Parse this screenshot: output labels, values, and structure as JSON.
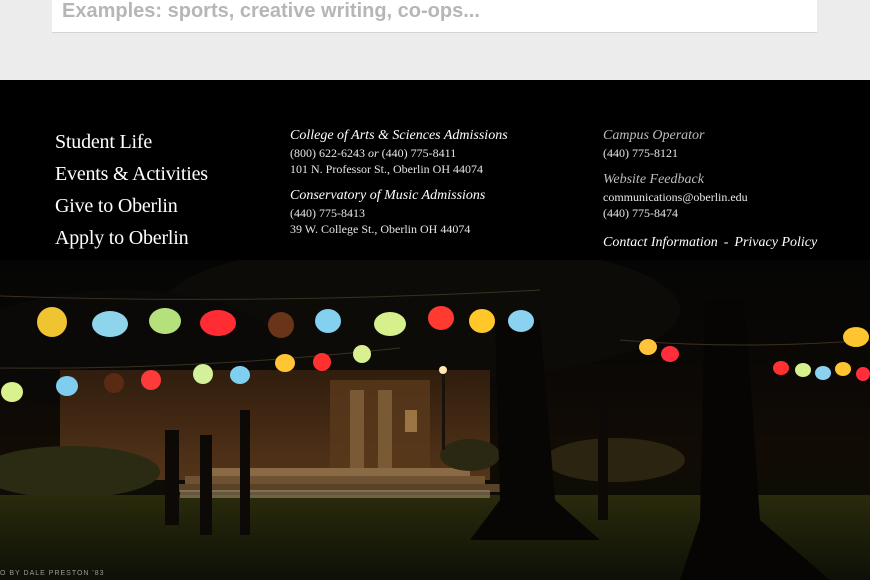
{
  "search": {
    "placeholder": "Examples: sports, creative writing, co-ops..."
  },
  "footer": {
    "nav": [
      "Student Life",
      "Events & Activities",
      "Give to Oberlin",
      "Apply to Oberlin"
    ],
    "arts_sciences": {
      "heading": "College of Arts & Sciences Admissions",
      "phone1": "(800) 622-6243",
      "or": "or",
      "phone2": "(440) 775-8411",
      "address": "101 N. Professor St., Oberlin OH 44074"
    },
    "conservatory": {
      "heading": "Conservatory of Music Admissions",
      "phone": "(440) 775-8413",
      "address": "39 W. College St., Oberlin OH 44074"
    },
    "campus_operator": {
      "heading": "Campus Operator",
      "phone": "(440) 775-8121"
    },
    "website_feedback": {
      "heading": "Website Feedback",
      "email": "communications@oberlin.edu",
      "phone": "(440) 775-8474"
    },
    "contact_link": "Contact Information",
    "separator": "-",
    "privacy_link": "Privacy Policy"
  },
  "photo": {
    "credit": "O BY DALE PRESTON '83"
  },
  "colors": {
    "page_band": "#ececec",
    "footer_bg": "#000000",
    "placeholder": "#b6b6b6",
    "muted_heading": "#bdbdbd"
  }
}
